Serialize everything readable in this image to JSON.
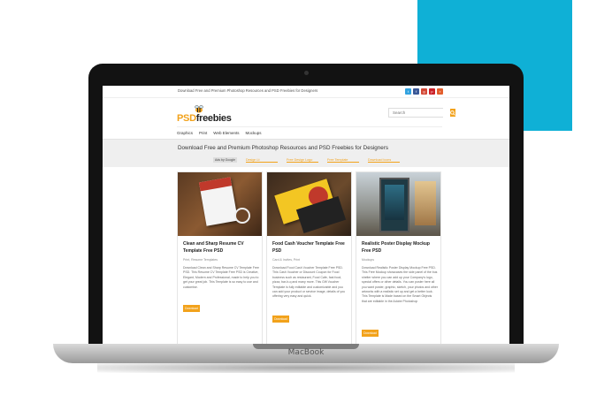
{
  "colors": {
    "accent_square": "#0fb0d6",
    "brand_orange": "#f2a21b"
  },
  "device": {
    "brand": "MacBook"
  },
  "site": {
    "tagline": "Download Free and Premium Photoshop Resources and PSD Freebies for Designers",
    "social_icons": [
      {
        "name": "twitter-icon",
        "glyph": "t",
        "color": "#33a3e0"
      },
      {
        "name": "facebook-icon",
        "glyph": "f",
        "color": "#3b5998"
      },
      {
        "name": "google-plus-icon",
        "glyph": "g",
        "color": "#d34836"
      },
      {
        "name": "pinterest-icon",
        "glyph": "p",
        "color": "#cb2027"
      },
      {
        "name": "rss-icon",
        "glyph": "r",
        "color": "#e35f2d"
      }
    ],
    "logo": {
      "part1": "PSD",
      "part2": "freebies"
    },
    "search": {
      "placeholder": "Search"
    },
    "nav": [
      "Graphics",
      "Print",
      "Web Elements",
      "Mockups"
    ],
    "hero": {
      "title": "Download Free and Premium Photoshop Resources and PSD Freebies for Designers",
      "badge": "Ads by Google",
      "links": [
        "Design Lt",
        "Free Design Logo",
        "Free Template",
        "Download Icons"
      ]
    },
    "cards": [
      {
        "title": "Clean and Sharp Resume CV Template Free PSD",
        "meta": "Print, Resume Templates",
        "desc": "Download Clean and Sharp Resume CV Template Free PSD. This Resume CV Template Free PSD is Creative, Elegant, Modern and Professional, made to help you to get your great job. This Template is so easy to use and customise.",
        "button": "Download"
      },
      {
        "title": "Food Cash Voucher Template Free PSD",
        "meta": "Card & Invites, Print",
        "desc": "Download Food Cash Voucher Template Free PSD. This Cash Voucher or Discount Coupon for Food business such as restaurant, Food Cafe, fast food, pizza, bar-b-q and many more. This Gift Voucher Template is fully editable and customizable and you can add your product or service image, details of you offering very easy and quick.",
        "button": "Download"
      },
      {
        "title": "Realistic Poster Display Mockup Free PSD",
        "meta": "Mockups",
        "desc": "Download Realistic Poster Display Mockup Free PSD. This Free Mockup showcases the side panel of the bus shelter where you can add up your Company's logo, special offers or other details. You can poster here all you want poster, graphic, sketch, your photos and other artworks with a realistic set up and get a better look. This Template is Made based on the Smart Objects that are editable in the Adobe Photoshop",
        "button": "Download"
      }
    ]
  }
}
